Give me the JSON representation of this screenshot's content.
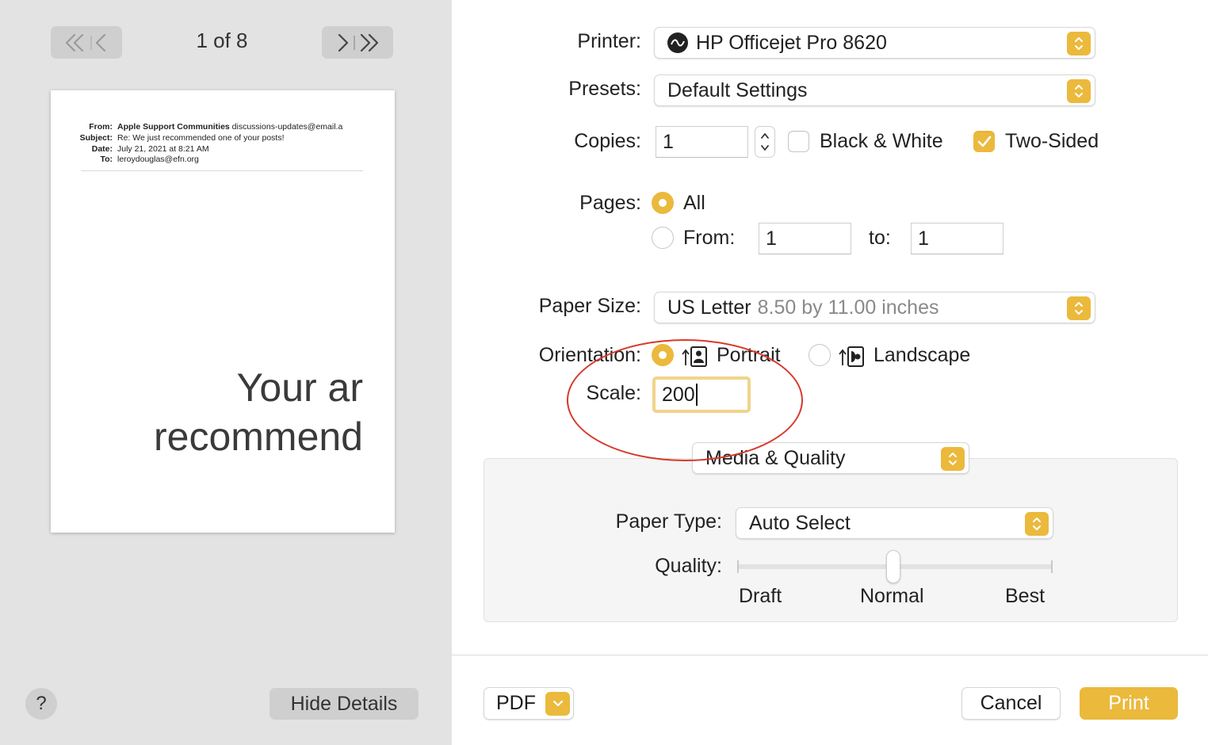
{
  "preview": {
    "page_indicator": "1 of 8",
    "email_header": {
      "from_label": "From:",
      "from_name": "Apple Support Communities",
      "from_address": "discussions-updates@email.a",
      "subject_label": "Subject:",
      "subject": "Re: We just recommended one of your posts!",
      "date_label": "Date:",
      "date": "July 21, 2021 at 8:21 AM",
      "to_label": "To:",
      "to": "leroydouglas@efn.org"
    },
    "body_line1": "Your ar",
    "body_line2": "recommend"
  },
  "footer_left": {
    "help_label": "?",
    "hide_details_label": "Hide Details"
  },
  "settings": {
    "printer_label": "Printer:",
    "printer_value": "HP Officejet Pro 8620",
    "presets_label": "Presets:",
    "presets_value": "Default Settings",
    "copies_label": "Copies:",
    "copies_value": "1",
    "black_white_label": "Black & White",
    "black_white_checked": false,
    "two_sided_label": "Two-Sided",
    "two_sided_checked": true,
    "pages_label": "Pages:",
    "pages_all_label": "All",
    "pages_from_label": "From:",
    "pages_from_value": "1",
    "pages_to_label": "to:",
    "pages_to_value": "1",
    "paper_size_label": "Paper Size:",
    "paper_size_value": "US Letter",
    "paper_size_detail": "8.50 by 11.00 inches",
    "orientation_label": "Orientation:",
    "portrait_label": "Portrait",
    "landscape_label": "Landscape",
    "scale_label": "Scale:",
    "scale_value": "200",
    "section_menu": "Media & Quality",
    "paper_type_label": "Paper Type:",
    "paper_type_value": "Auto Select",
    "quality_label": "Quality:",
    "quality_levels": [
      "Draft",
      "Normal",
      "Best"
    ],
    "quality_selected": "Normal"
  },
  "buttons": {
    "pdf_label": "PDF",
    "cancel_label": "Cancel",
    "print_label": "Print"
  },
  "colors": {
    "accent": "#ebb93c",
    "annotation": "#d7392b"
  }
}
